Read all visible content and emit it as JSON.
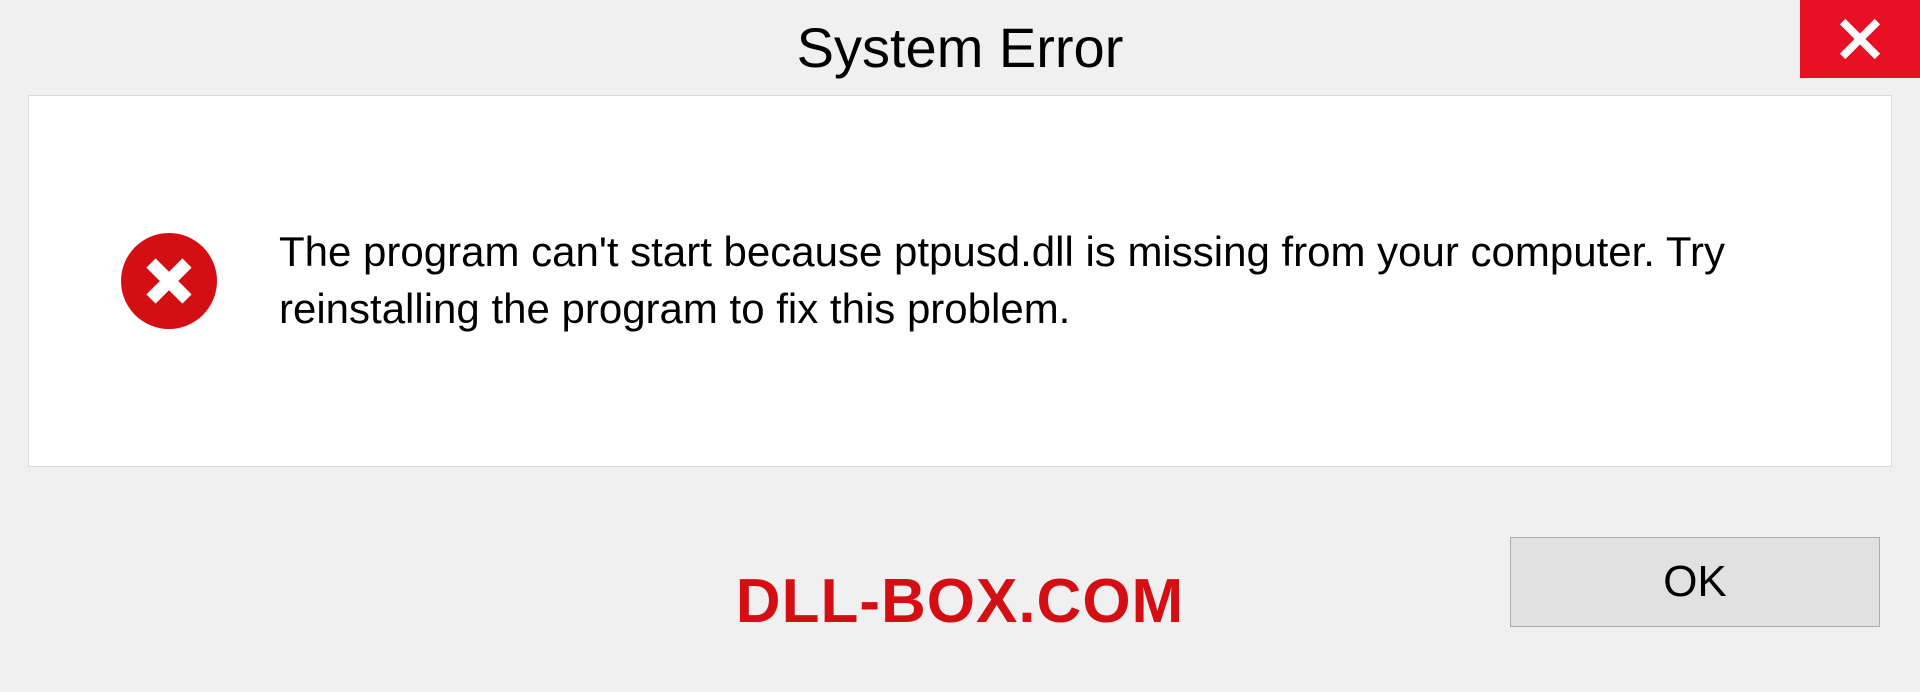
{
  "dialog": {
    "title": "System Error",
    "message": "The program can't start because ptpusd.dll is missing from your computer. Try reinstalling the program to fix this problem.",
    "ok_label": "OK"
  },
  "watermark": "DLL-BOX.COM",
  "icons": {
    "close": "close-icon",
    "error": "error-circle-icon"
  },
  "colors": {
    "close_bg": "#e81123",
    "error_red": "#d40f14",
    "watermark_red": "#d40f14"
  }
}
